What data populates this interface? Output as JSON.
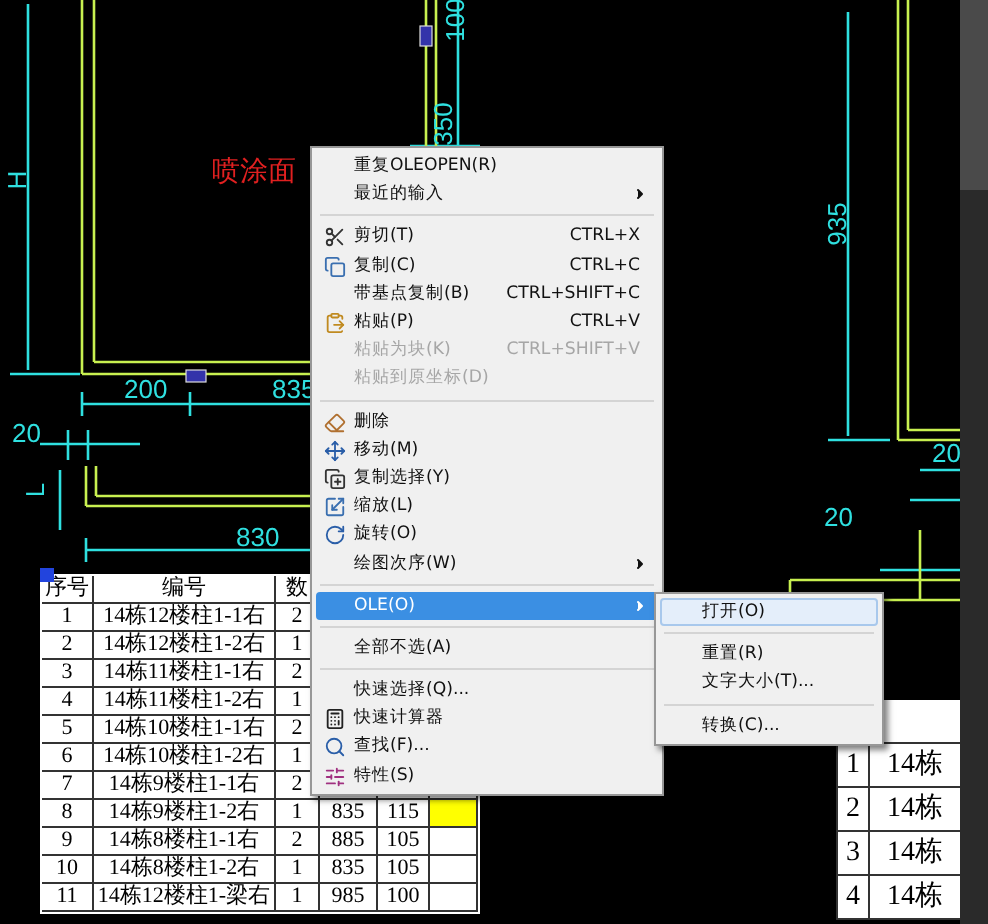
{
  "drawing": {
    "labels": [
      {
        "text": "喷涂面",
        "kind": "note"
      },
      {
        "text": "H",
        "kind": "dimension"
      },
      {
        "text": "350",
        "kind": "dimension"
      },
      {
        "text": "100",
        "kind": "dimension"
      },
      {
        "text": "935",
        "kind": "dimension"
      },
      {
        "text": "200",
        "kind": "dimension"
      },
      {
        "text": "835",
        "kind": "dimension"
      },
      {
        "text": "20",
        "kind": "dimension"
      },
      {
        "text": "L",
        "kind": "dimension"
      },
      {
        "text": "830",
        "kind": "dimension"
      },
      {
        "text": "20",
        "kind": "dimension"
      },
      {
        "text": "20",
        "kind": "dimension"
      }
    ]
  },
  "table": {
    "columns": [
      "序号",
      "编号",
      "数"
    ],
    "rows": [
      {
        "cells": [
          "1",
          "14栋12楼柱1-1右",
          "2"
        ]
      },
      {
        "cells": [
          "2",
          "14栋12楼柱1-2右",
          "1"
        ]
      },
      {
        "cells": [
          "3",
          "14栋11楼柱1-1右",
          "2"
        ]
      },
      {
        "cells": [
          "4",
          "14栋11楼柱1-2右",
          "1"
        ]
      },
      {
        "cells": [
          "5",
          "14栋10楼柱1-1右",
          "2"
        ]
      },
      {
        "cells": [
          "6",
          "14栋10楼柱1-2右",
          "1"
        ]
      },
      {
        "cells": [
          "7",
          "14栋9楼柱1-1右",
          "2"
        ]
      },
      {
        "cells": [
          "8",
          "14栋9楼柱1-2右",
          "1",
          "835",
          "115"
        ],
        "highlighted": true
      },
      {
        "cells": [
          "9",
          "14栋8楼柱1-1右",
          "2",
          "885",
          "105"
        ],
        "highlighted": false
      },
      {
        "cells": [
          "10",
          "14栋8楼柱1-2右",
          "1",
          "835",
          "105"
        ],
        "highlighted": false
      },
      {
        "cells": [
          "11",
          "14栋12楼柱1-梁右",
          "1",
          "985",
          "100"
        ],
        "highlighted": false
      }
    ]
  },
  "table_2": {
    "rows": [
      {
        "cells": [
          "1",
          "14栋"
        ]
      },
      {
        "cells": [
          "2",
          "14栋"
        ]
      },
      {
        "cells": [
          "3",
          "14栋"
        ]
      },
      {
        "cells": [
          "4",
          "14栋"
        ]
      }
    ]
  },
  "context_menu": {
    "items": [
      {
        "kind": "item",
        "label": "重复OLEOPEN(R)",
        "disabled": false,
        "submenu": false,
        "selected": false
      },
      {
        "kind": "item",
        "label": "最近的输入",
        "disabled": false,
        "submenu": true,
        "selected": false
      },
      {
        "kind": "separator"
      },
      {
        "kind": "item",
        "label": "剪切(T)",
        "shortcut": "CTRL+X",
        "disabled": false,
        "submenu": false,
        "selected": false
      },
      {
        "kind": "item",
        "label": "复制(C)",
        "shortcut": "CTRL+C",
        "disabled": false,
        "submenu": false,
        "selected": false
      },
      {
        "kind": "item",
        "label": "带基点复制(B)",
        "shortcut": "CTRL+SHIFT+C",
        "disabled": false,
        "submenu": false,
        "selected": false
      },
      {
        "kind": "item",
        "label": "粘贴(P)",
        "shortcut": "CTRL+V",
        "disabled": false,
        "submenu": false,
        "selected": false
      },
      {
        "kind": "item",
        "label": "粘贴为块(K)",
        "shortcut": "CTRL+SHIFT+V",
        "disabled": true,
        "submenu": false,
        "selected": false
      },
      {
        "kind": "item",
        "label": "粘贴到原坐标(D)",
        "disabled": true,
        "submenu": false,
        "selected": false
      },
      {
        "kind": "separator"
      },
      {
        "kind": "item",
        "label": "删除",
        "disabled": false,
        "submenu": false,
        "selected": false
      },
      {
        "kind": "item",
        "label": "移动(M)",
        "disabled": false,
        "submenu": false,
        "selected": false
      },
      {
        "kind": "item",
        "label": "复制选择(Y)",
        "disabled": false,
        "submenu": false,
        "selected": false
      },
      {
        "kind": "item",
        "label": "缩放(L)",
        "disabled": false,
        "submenu": false,
        "selected": false
      },
      {
        "kind": "item",
        "label": "旋转(O)",
        "disabled": false,
        "submenu": false,
        "selected": false
      },
      {
        "kind": "item",
        "label": "绘图次序(W)",
        "disabled": false,
        "submenu": true,
        "selected": false
      },
      {
        "kind": "separator"
      },
      {
        "kind": "item",
        "label": "OLE(O)",
        "disabled": false,
        "submenu": true,
        "selected": true
      },
      {
        "kind": "separator"
      },
      {
        "kind": "item",
        "label": "全部不选(A)",
        "disabled": false,
        "submenu": false,
        "selected": false
      },
      {
        "kind": "separator"
      },
      {
        "kind": "item",
        "label": "快速选择(Q)...",
        "disabled": false,
        "submenu": false,
        "selected": false
      },
      {
        "kind": "item",
        "label": "快速计算器",
        "disabled": false,
        "submenu": false,
        "selected": false
      },
      {
        "kind": "item",
        "label": "查找(F)...",
        "disabled": false,
        "submenu": false,
        "selected": false
      },
      {
        "kind": "item",
        "label": "特性(S)",
        "disabled": false,
        "submenu": false,
        "selected": false
      }
    ]
  },
  "submenu": {
    "items": [
      {
        "kind": "item",
        "label": "打开(O)",
        "selected": true
      },
      {
        "kind": "separator"
      },
      {
        "kind": "item",
        "label": "重置(R)",
        "selected": false
      },
      {
        "kind": "item",
        "label": "文字大小(T)...",
        "selected": false
      },
      {
        "kind": "separator"
      },
      {
        "kind": "item",
        "label": "转换(C)...",
        "selected": false
      }
    ]
  }
}
